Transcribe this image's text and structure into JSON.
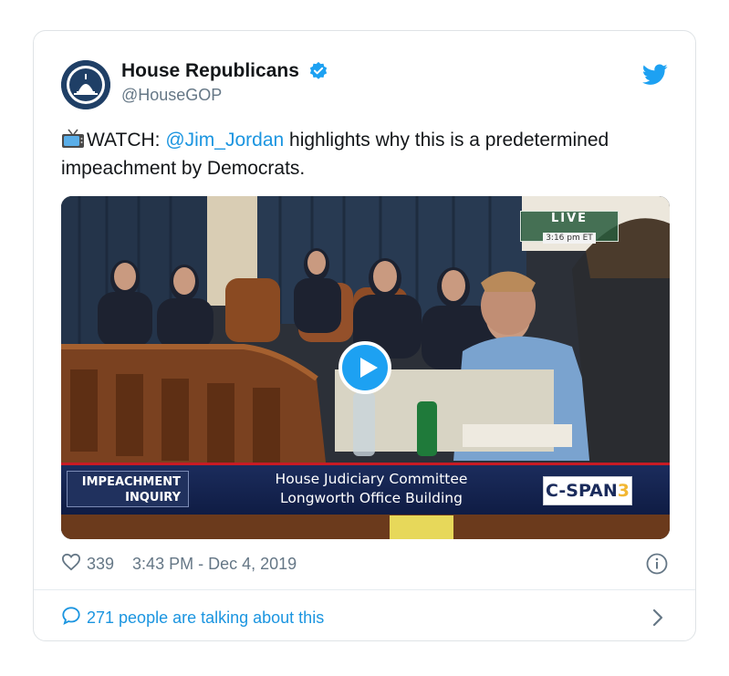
{
  "author": {
    "name": "House Republicans",
    "handle": "@HouseGOP"
  },
  "tweet": {
    "lead": "WATCH: ",
    "mention": "@Jim_Jordan",
    "rest": " highlights why this is a predetermined impeachment by Democrats."
  },
  "media": {
    "live_label": "LIVE",
    "live_time": "3:16 pm ET",
    "chyron_tag_line1": "IMPEACHMENT",
    "chyron_tag_line2": "INQUIRY",
    "chyron_line1": "House Judiciary Committee",
    "chyron_line2": "Longworth Office Building",
    "network": "C-SPAN",
    "network_number": "3"
  },
  "footer": {
    "likes": "339",
    "timestamp": "3:43 PM - Dec 4, 2019",
    "talking": "271 people are talking about this"
  },
  "icons": {
    "verified": "verified-badge-icon",
    "twitter": "twitter-bird-icon",
    "heart": "heart-icon",
    "info": "info-icon",
    "comment": "comment-bubble-icon",
    "chevron": "chevron-right-icon"
  },
  "colors": {
    "accent": "#1da1f2",
    "link": "#1b95e0",
    "muted": "#657786"
  }
}
